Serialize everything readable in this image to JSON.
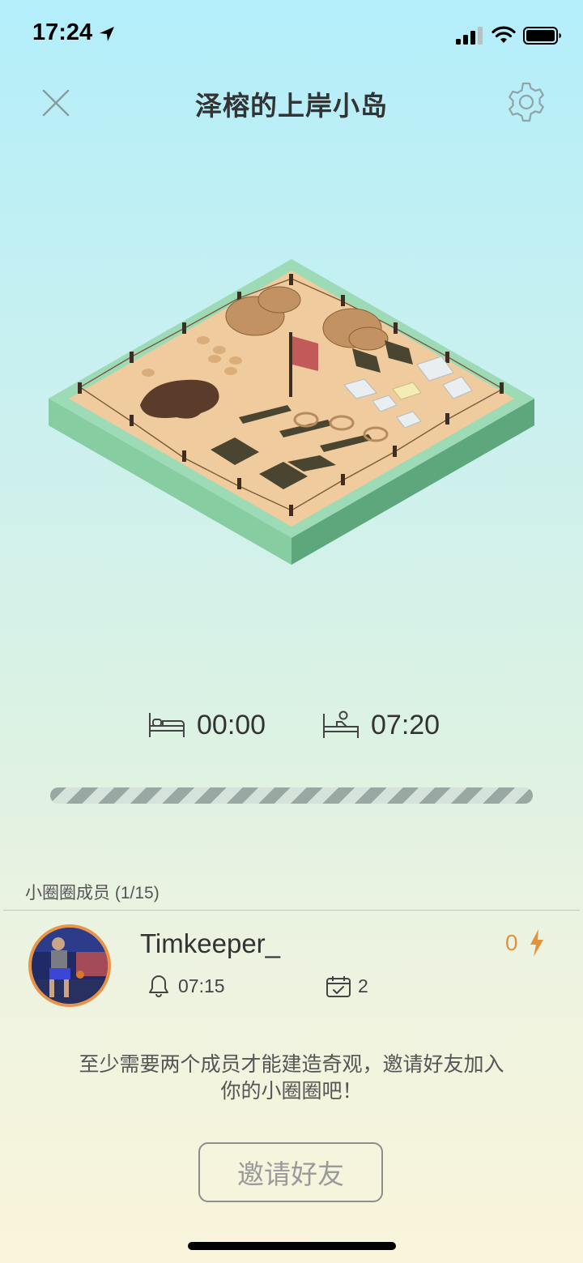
{
  "status_bar": {
    "time": "17:24"
  },
  "header": {
    "title": "泽榕的上岸小岛"
  },
  "schedule": {
    "bedtime": "00:00",
    "wake_time": "07:20"
  },
  "progress": {
    "fraction": 0
  },
  "members": {
    "title": "小圈圈成员 (1/15)",
    "list": [
      {
        "name": "Timkeeper_",
        "score": "0",
        "alarm": "07:15",
        "days": "2"
      }
    ]
  },
  "notice": {
    "line1": "至少需要两个成员才能建造奇观，邀请好友加入",
    "line2": "你的小圈圈吧！"
  },
  "invite": {
    "label": "邀请好友"
  },
  "colors": {
    "accent": "#e0933e",
    "island_grass": "#7fc7a1",
    "sand": "#eec99d"
  },
  "icons": [
    "location-arrow-icon",
    "signal-icon",
    "wifi-icon",
    "battery-icon",
    "close-icon",
    "gear-icon",
    "bed-icon",
    "wake-up-icon",
    "lightning-icon",
    "bell-icon",
    "calendar-check-icon"
  ]
}
